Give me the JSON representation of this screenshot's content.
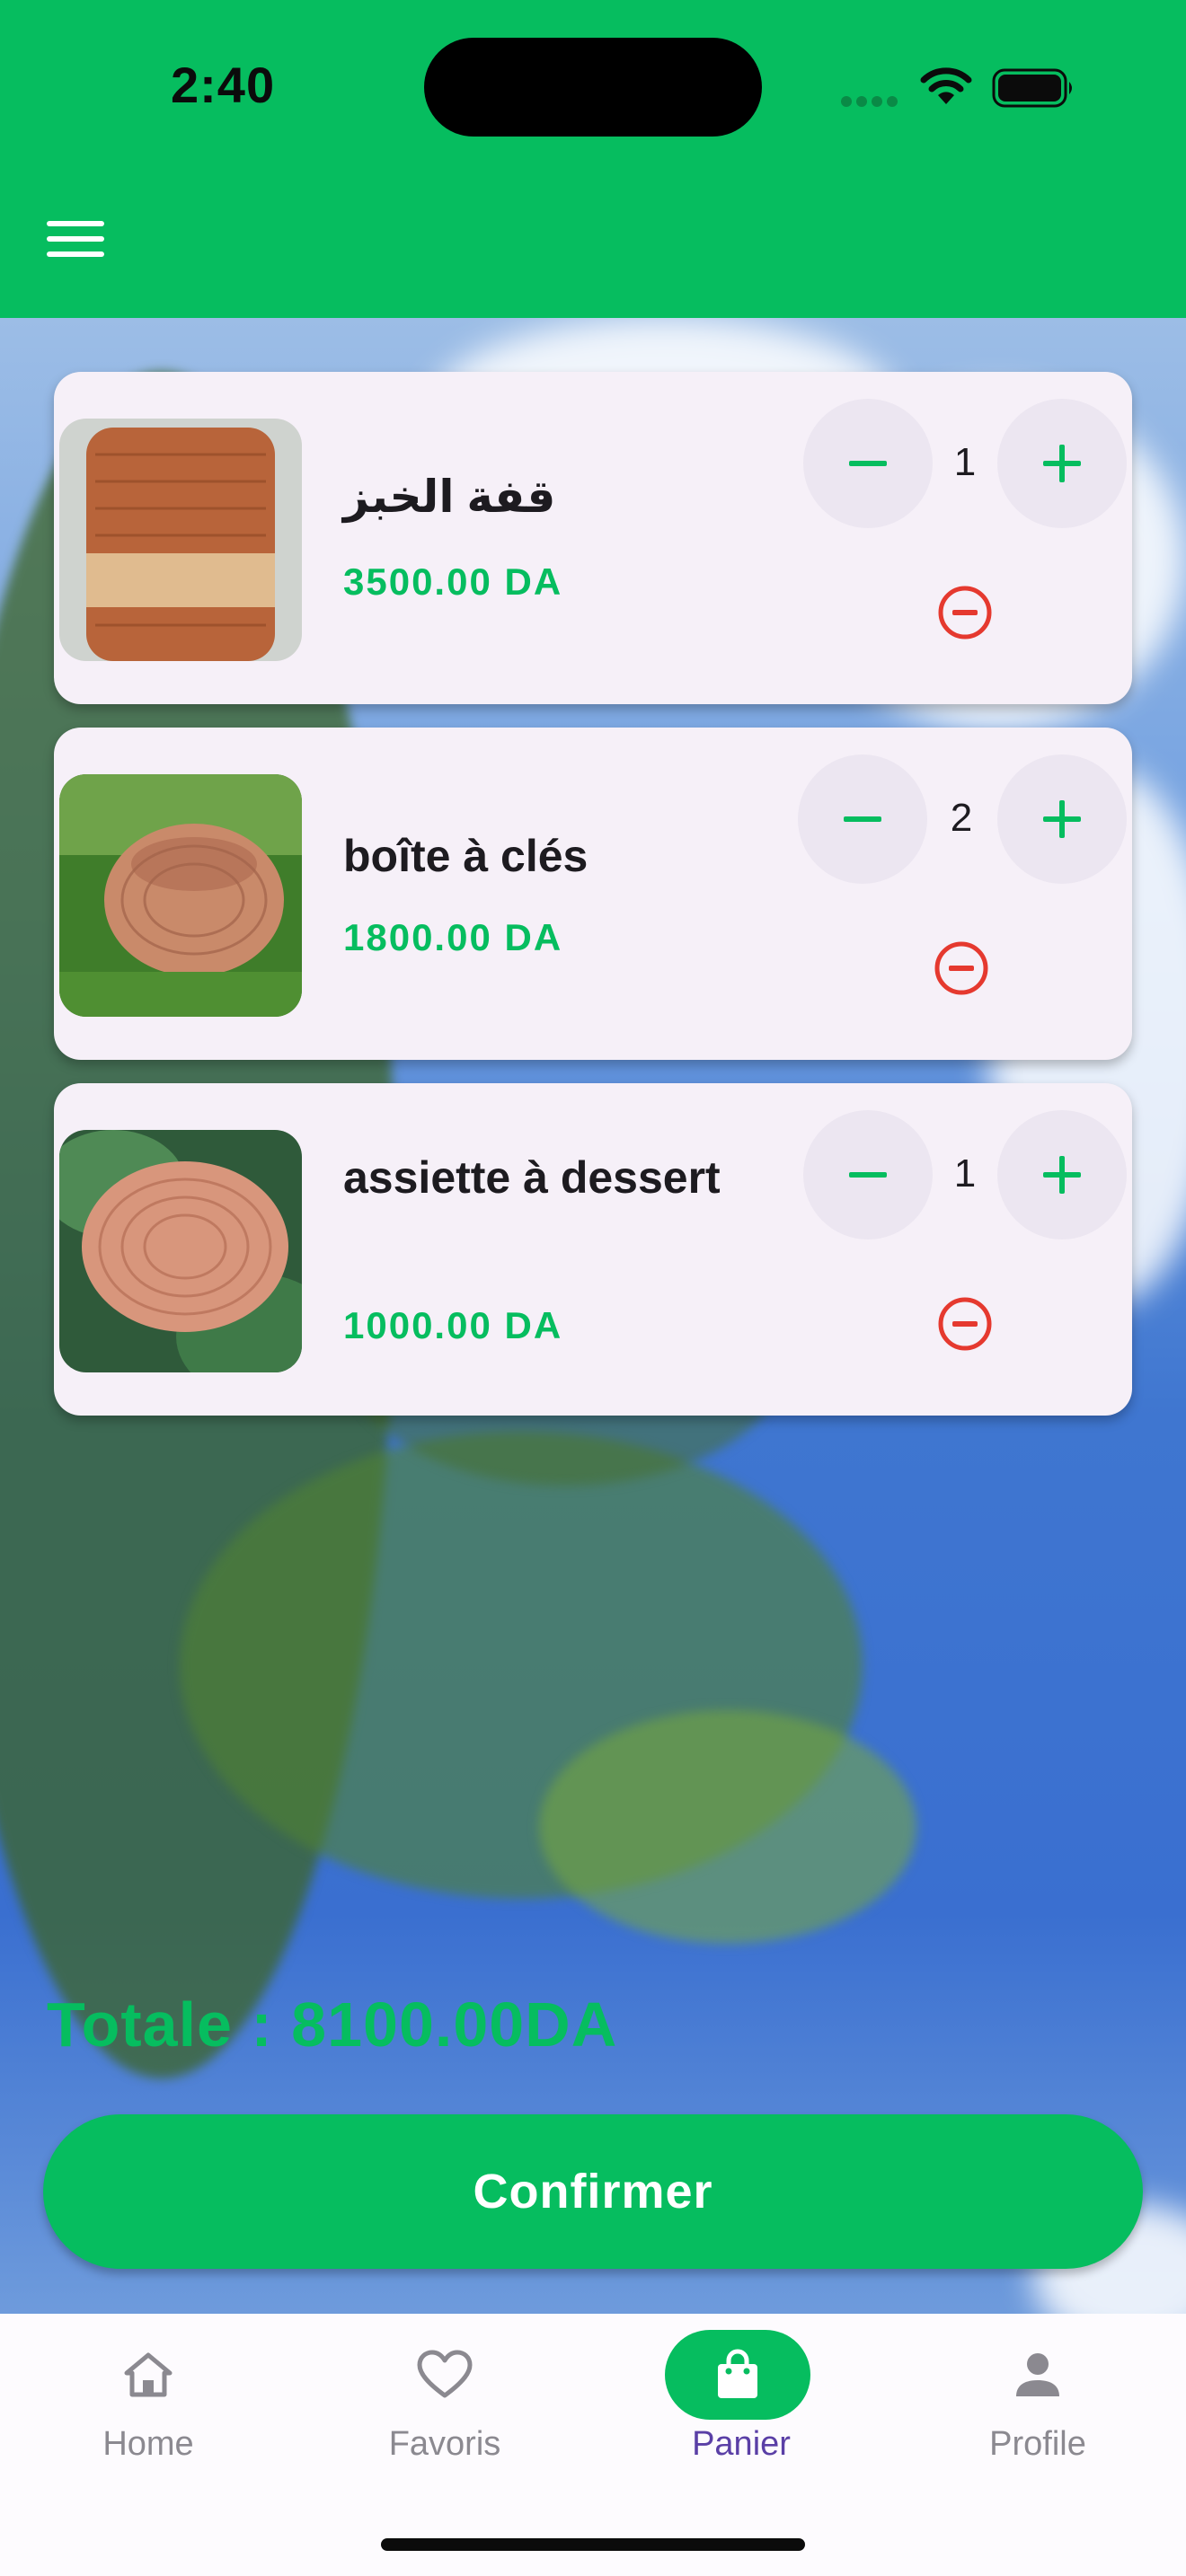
{
  "status_bar": {
    "time": "2:40",
    "signal_icon": "signal-dots-icon",
    "wifi_icon": "wifi-icon",
    "battery_icon": "battery-icon"
  },
  "app_bar": {
    "menu_icon": "menu-icon"
  },
  "colors": {
    "brand_green": "#06bd5f",
    "card_bg": "#f6f0f8",
    "qty_button_bg": "#ece6f1",
    "remove_red": "#e5392f",
    "active_nav_label": "#5a3fa6"
  },
  "cart": {
    "items": [
      {
        "name": "قفة الخبز",
        "price": "3500.00 DA",
        "quantity": "1"
      },
      {
        "name": "boîte à clés",
        "price": "1800.00 DA",
        "quantity": "2"
      },
      {
        "name": "assiette à dessert",
        "price": "1000.00 DA",
        "quantity": "1"
      }
    ],
    "total": "Totale : 8100.00DA",
    "confirm_label": "Confirmer"
  },
  "bottom_nav": {
    "items": [
      {
        "label": "Home",
        "icon": "home-icon"
      },
      {
        "label": "Favoris",
        "icon": "heart-icon"
      },
      {
        "label": "Panier",
        "icon": "shopping-bag-icon",
        "active": true
      },
      {
        "label": "Profile",
        "icon": "person-icon"
      }
    ]
  }
}
